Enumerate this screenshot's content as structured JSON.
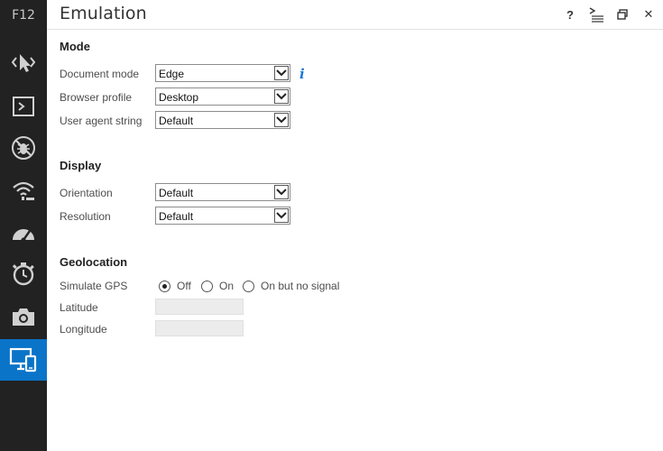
{
  "sidebar": {
    "label": "F12",
    "items": [
      {
        "name": "dom-explorer",
        "icon": "cursor-select-icon"
      },
      {
        "name": "console",
        "icon": "console-icon"
      },
      {
        "name": "debugger",
        "icon": "bug-icon"
      },
      {
        "name": "network",
        "icon": "wifi-icon"
      },
      {
        "name": "performance",
        "icon": "speedometer-icon"
      },
      {
        "name": "memory",
        "icon": "stopwatch-icon"
      },
      {
        "name": "profiler",
        "icon": "camera-icon"
      },
      {
        "name": "emulation",
        "icon": "devices-icon",
        "active": true
      }
    ],
    "active_color": "#0a74c9"
  },
  "header": {
    "title": "Emulation",
    "help_label": "?",
    "close_label": "✕"
  },
  "mode": {
    "title": "Mode",
    "document_mode": {
      "label": "Document mode",
      "value": "Edge"
    },
    "browser_profile": {
      "label": "Browser profile",
      "value": "Desktop"
    },
    "user_agent": {
      "label": "User agent string",
      "value": "Default"
    },
    "info_label": "i"
  },
  "display": {
    "title": "Display",
    "orientation": {
      "label": "Orientation",
      "value": "Default"
    },
    "resolution": {
      "label": "Resolution",
      "value": "Default"
    }
  },
  "geolocation": {
    "title": "Geolocation",
    "simulate_gps": {
      "label": "Simulate GPS",
      "options": [
        "Off",
        "On",
        "On but no signal"
      ],
      "selected": "Off"
    },
    "latitude": {
      "label": "Latitude",
      "value": ""
    },
    "longitude": {
      "label": "Longitude",
      "value": ""
    }
  }
}
